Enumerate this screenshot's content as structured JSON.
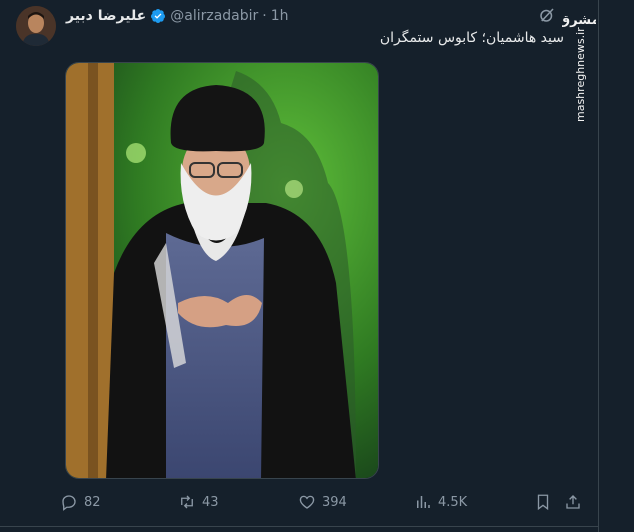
{
  "tweet": {
    "author_name": "علیرضا دبیر",
    "handle": "@alirzadabir",
    "separator": "·",
    "time": "1h",
    "text": "سید هاشمیان؛ کابوس ستمگران"
  },
  "watermark": {
    "logo_text": "مشرق",
    "site": "mashreghnews.ir"
  },
  "actions": {
    "replies": "82",
    "retweets": "43",
    "likes": "394",
    "views": "4.5K"
  },
  "colors": {
    "background": "#15202b",
    "text": "#e7e9ea",
    "muted": "#8b98a5",
    "verified": "#1d9bf0",
    "border": "#38444d"
  },
  "icons": {
    "verified": "verified-badge-icon",
    "grok": "grok-icon",
    "reply": "reply-icon",
    "retweet": "retweet-icon",
    "like": "heart-icon",
    "views": "views-icon",
    "bookmark": "bookmark-icon",
    "share": "share-icon"
  }
}
